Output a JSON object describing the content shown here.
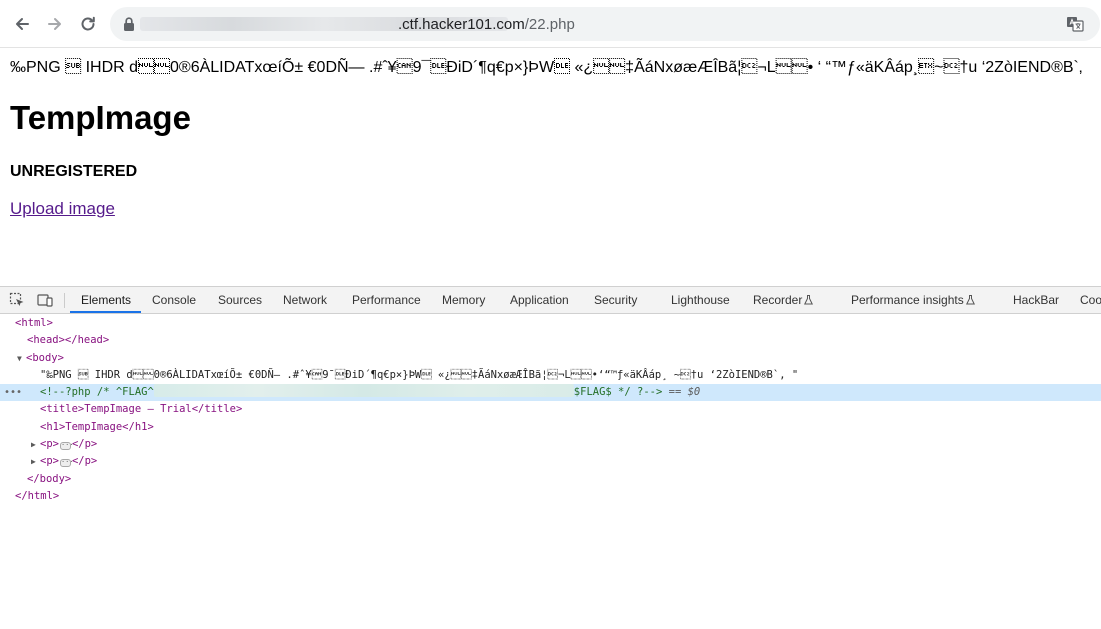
{
  "browser": {
    "url_host": ".ctf.hacker101.com",
    "url_path": "/22.php"
  },
  "page": {
    "png_garbage": "‰PNG \u001a IHDR d\u0000\u00000®6ÀLIDATxœíÕ± €0DÑ— .#ˆ¥\u00189¯\u0010ÐiD´¶q€p×}ÞW\u0010 «¿\u0000\u0000‡ÃáNxøæÆÎBã¦\u0012¬L\u0000\u0000•  ‘  “™ƒ«äKÂáp¸\u0003~\u0012†u    ‘2ZòIEND®B`‚",
    "heading": "TempImage",
    "status": "UNREGISTERED",
    "upload_link": "Upload image"
  },
  "devtools": {
    "tabs": [
      "Elements",
      "Console",
      "Sources",
      "Network",
      "Performance",
      "Memory",
      "Application",
      "Security",
      "Lighthouse",
      "Recorder",
      "Performance insights",
      "HackBar",
      "Coo"
    ],
    "dom": {
      "html_open": "<html>",
      "head": "<head></head>",
      "body_open": "<body>",
      "text_node": "\"‰PNG \u001a IHDR d\u0000\u00000®6ÀLIDATxœíÕ± €0DÑ— .#ˆ¥\u00189¯\u0010ÐiD´¶q€p×}ÞW\u0010 «¿\u0000\u0000‡ÃáNxøæÆÎBã¦\u0012¬L\u0000\u0000•‘“™ƒ«äKÂáp¸ ~\u0012†u ‘2ZòIEND®B`‚ \"",
      "comment_start": "<!--?php /* ^FLAG^",
      "comment_end": "$FLAG$ */ ?-->",
      "eq_dollar": "== $0",
      "title_tag": "<title>TempImage — Trial</title>",
      "h1_tag": "<h1>TempImage</h1>",
      "p_open": "<p>",
      "p_close": "</p>",
      "body_close": "</body>",
      "html_close": "</html>"
    }
  },
  "colors": {
    "tag": "#881280",
    "comment": "#236e25",
    "selection": "#cfe8fc",
    "active_tab_underline": "#1a73e8",
    "visited_link": "#551a8b"
  }
}
